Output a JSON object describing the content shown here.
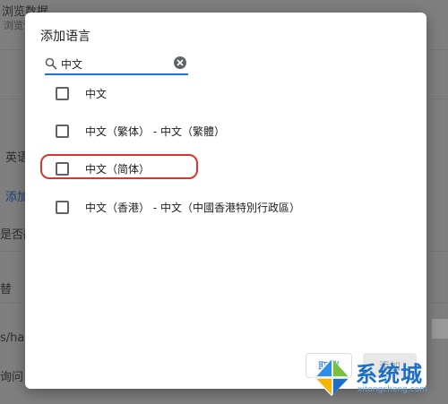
{
  "background": {
    "items": [
      {
        "text": "浏览数据"
      },
      {
        "text": "浏览记"
      },
      {
        "text": "英语"
      },
      {
        "text": "添加"
      },
      {
        "text": "是否翻"
      },
      {
        "text": "替"
      },
      {
        "text": "s/han"
      },
      {
        "text": "询问"
      }
    ]
  },
  "dialog": {
    "title": "添加语言",
    "search": {
      "value": "中文",
      "placeholder": ""
    },
    "languages": [
      {
        "label": "中文",
        "checked": false
      },
      {
        "label": "中文（繁体） - 中文（繁體）",
        "checked": false
      },
      {
        "label": "中文（简体）",
        "checked": false,
        "highlighted": true
      },
      {
        "label": "中文（香港） - 中文（中國香港特別行政區）",
        "checked": false
      }
    ],
    "cancel_label": "取消",
    "add_label": "添加"
  },
  "watermark": {
    "text": "系统城",
    "url": "xitongcheng.com"
  },
  "colors": {
    "accent": "#1a73e8",
    "highlight": "#d9352c",
    "overlay": "#7f7f7f"
  }
}
